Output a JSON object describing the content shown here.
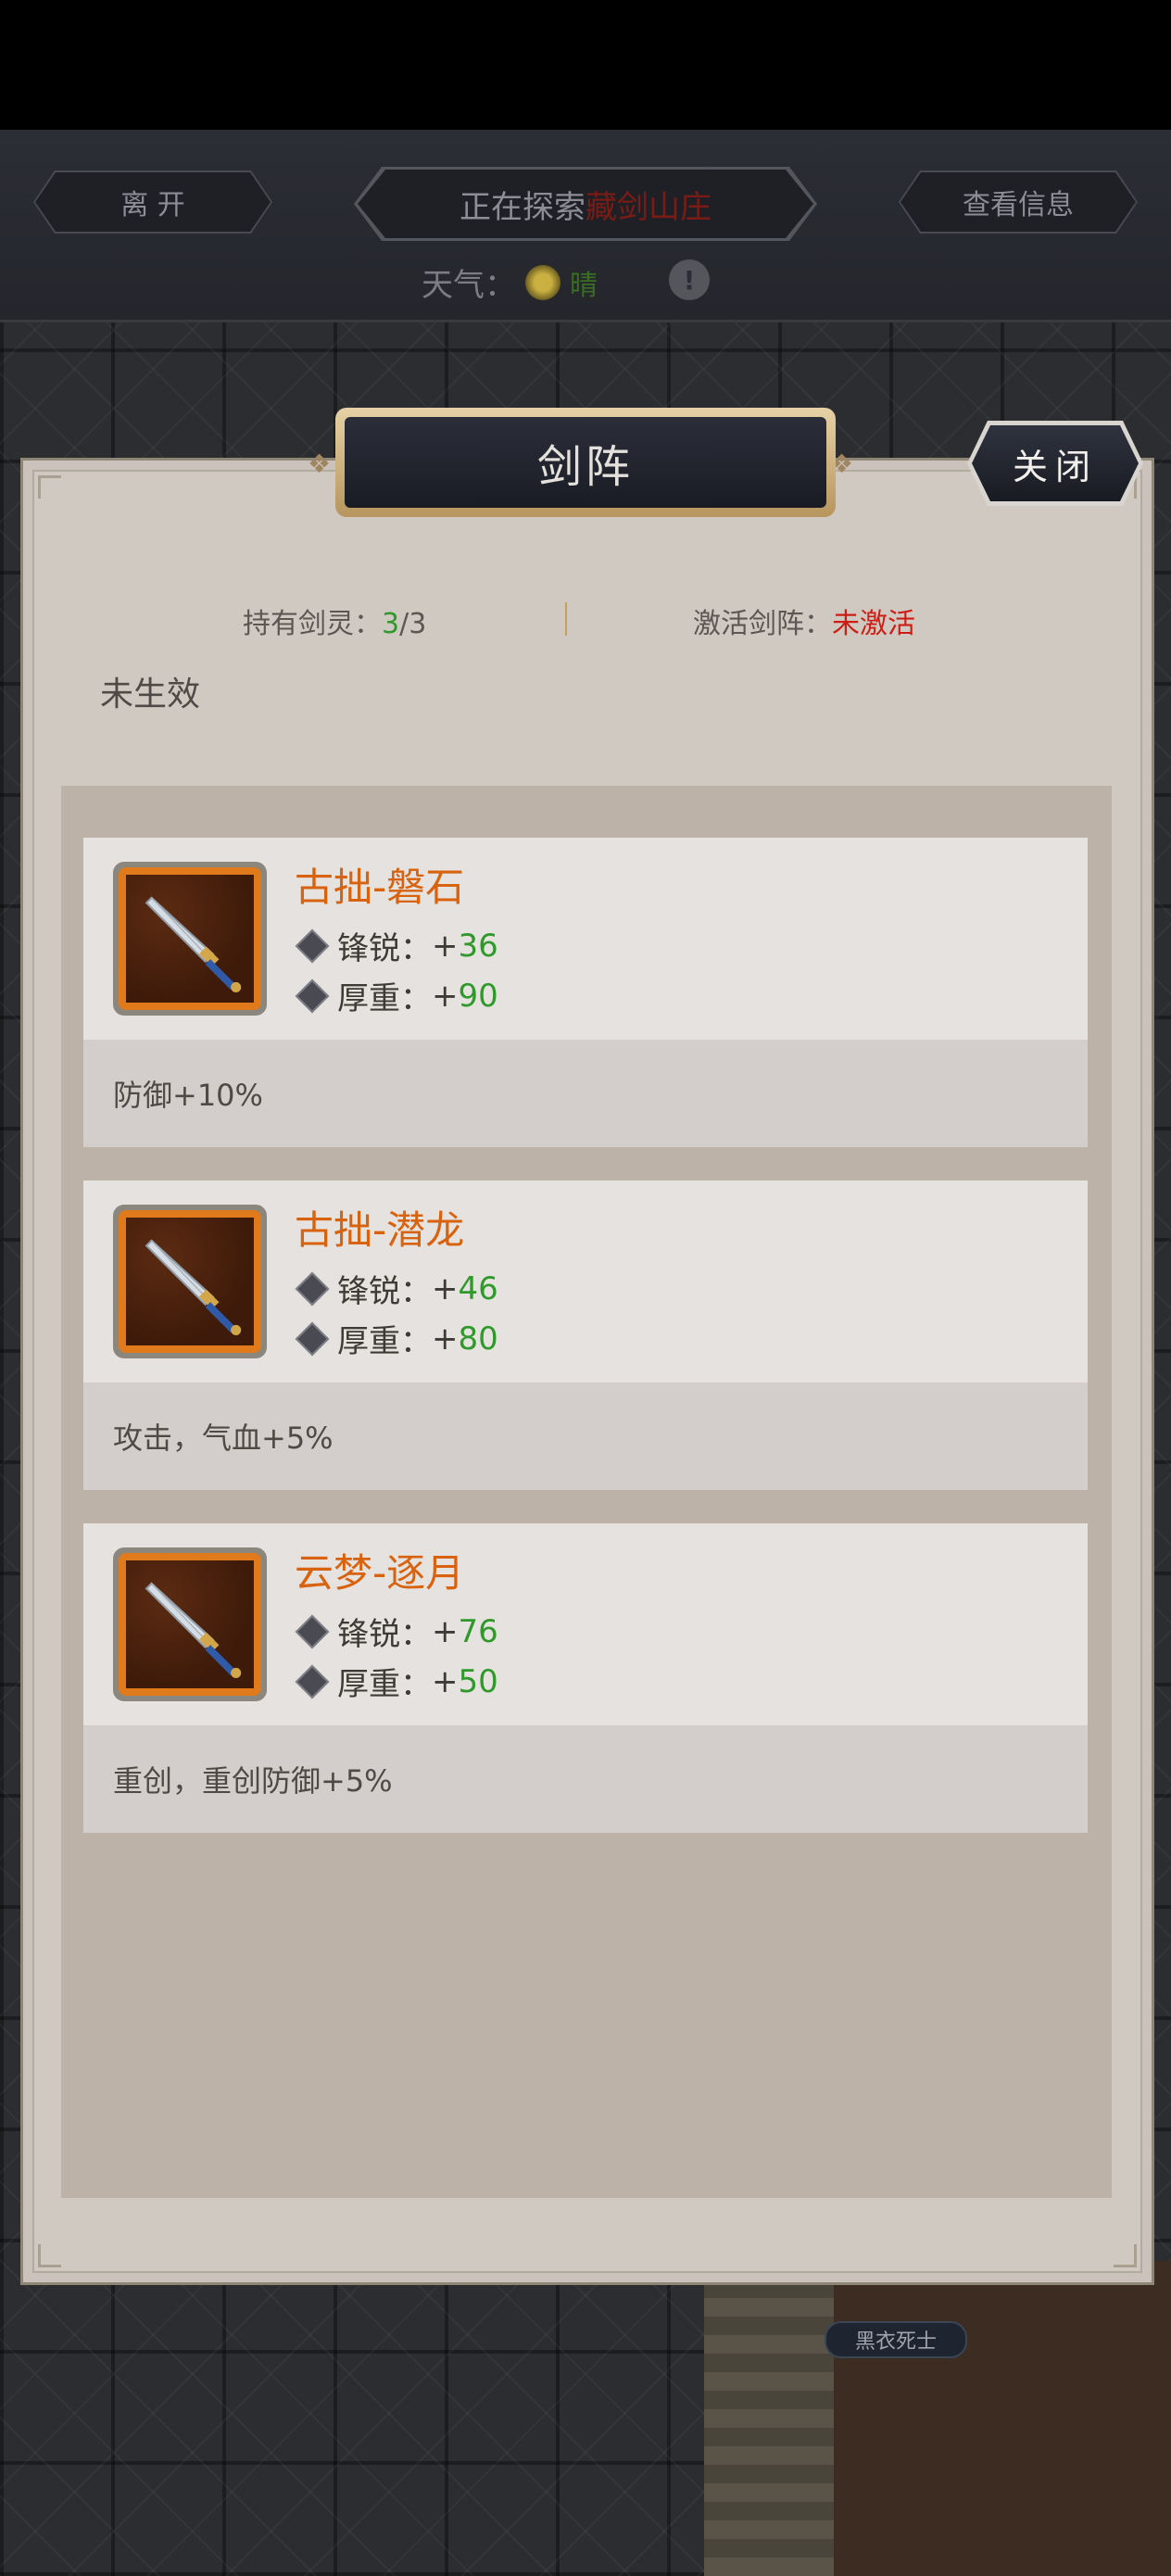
{
  "header": {
    "leave_label": "离 开",
    "exploring_prefix": "正在探索",
    "exploring_location": "藏剑山庄",
    "info_label": "查看信息",
    "weather_label": "天气：",
    "weather_value": "晴",
    "warn_symbol": "!"
  },
  "map": {
    "npc_name": "黑衣死士"
  },
  "panel": {
    "title": "剑阵",
    "close_label": "关闭",
    "held_label": "持有剑灵：",
    "held_count": "3",
    "held_total": "/3",
    "active_label": "激活剑阵：",
    "active_value": "未激活",
    "effect_status": "未生效"
  },
  "cards": [
    {
      "name": "古拙-磐石",
      "attr1_label": "锋锐：",
      "attr1_value": "36",
      "attr2_label": "厚重：",
      "attr2_value": "90",
      "bonus": "防御+10%",
      "icon": "sword-icon"
    },
    {
      "name": "古拙-潜龙",
      "attr1_label": "锋锐：",
      "attr1_value": "46",
      "attr2_label": "厚重：",
      "attr2_value": "80",
      "bonus": "攻击，气血+5%",
      "icon": "sword-icon"
    },
    {
      "name": "云梦-逐月",
      "attr1_label": "锋锐：",
      "attr1_value": "76",
      "attr2_label": "厚重：",
      "attr2_value": "50",
      "bonus": "重创，重创防御+5%",
      "icon": "sword-icon"
    }
  ],
  "colors": {
    "name_orange": "#d8620e",
    "value_green": "#2f9a2a",
    "inactive_red": "#cc1e14"
  }
}
